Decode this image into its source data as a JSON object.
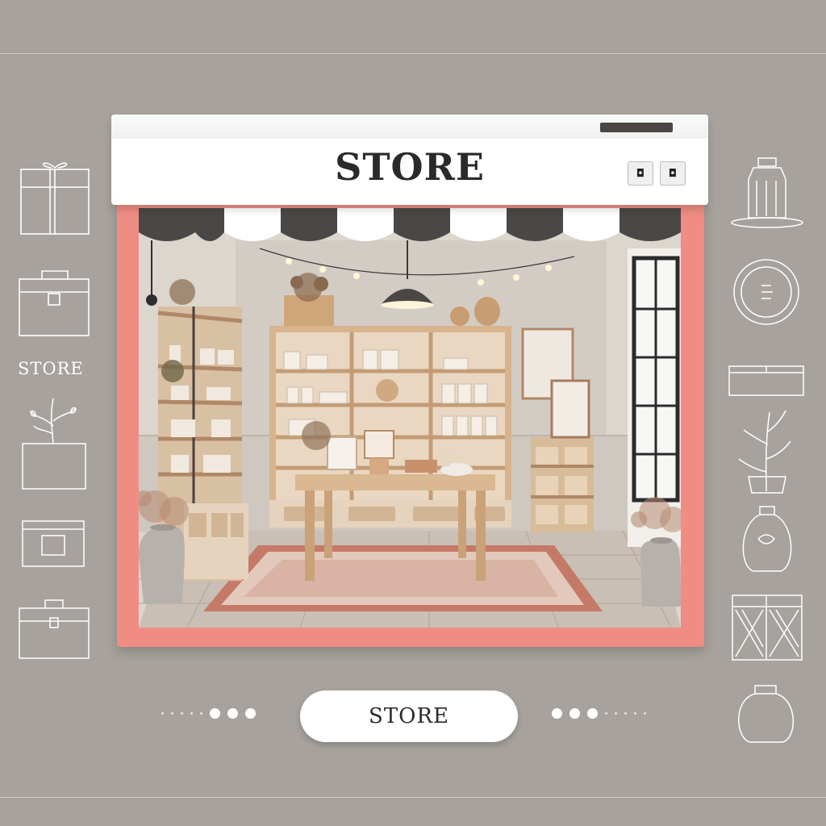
{
  "sign": {
    "title": "STORE",
    "buttons": [
      "◘",
      "◘"
    ]
  },
  "side": {
    "left_label": "STORE",
    "left_icons": [
      "gift-box-icon",
      "briefcase-icon",
      "potted-plant-icon",
      "wallet-icon",
      "bag-icon"
    ],
    "right_icons": [
      "jar-icon",
      "coin-icon",
      "box-tray-icon",
      "plant-sprig-icon",
      "vase-icon",
      "package-icon",
      "pot-icon"
    ]
  },
  "cta": {
    "label": "STORE"
  },
  "colors": {
    "background": "#a7a29d",
    "frame": "#ef8d84",
    "awning_dark": "#4a4847",
    "awning_light": "#ffffff",
    "wood": "#d7b48e"
  }
}
